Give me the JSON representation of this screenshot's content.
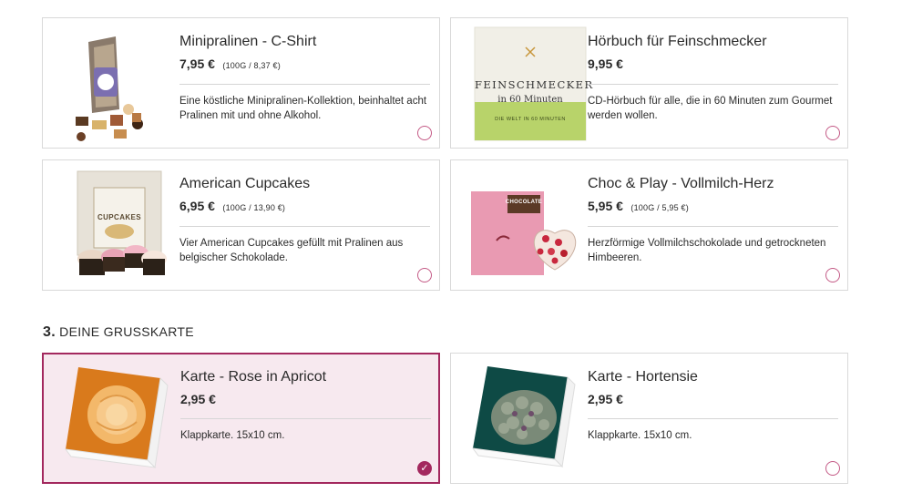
{
  "products": [
    {
      "title": "Minipralinen - C-Shirt",
      "price": "7,95 €",
      "unit": "(100G / 8,37 €)",
      "desc": "Eine köstliche Minipralinen-Kollektion, beinhaltet acht Pralinen mit und ohne Alkohol.",
      "icon": "pralines-image",
      "selected": false
    },
    {
      "title": "Hörbuch für Feinschmecker",
      "price": "9,95 €",
      "unit": "",
      "desc": "CD-Hörbuch für alle, die in 60 Minuten zum Gourmet werden wollen.",
      "icon": "audiobook-image",
      "selected": false,
      "cover": {
        "title": "FEINSCHMECKER",
        "subtitle": "in 60 Minuten",
        "band": "DIE WELT IN 60 MINUTEN"
      }
    },
    {
      "title": "American Cupcakes",
      "price": "6,95 €",
      "unit": "(100G / 13,90 €)",
      "desc": "Vier American Cupcakes gefüllt mit Pralinen aus belgischer Schokolade.",
      "icon": "cupcakes-image",
      "selected": false,
      "box_label": "CUPCAKES"
    },
    {
      "title": "Choc & Play - Vollmilch-Herz",
      "price": "5,95 €",
      "unit": "(100G / 5,95 €)",
      "desc": "Herzförmige Vollmilchschokolade und getrockneten Himbeeren.",
      "icon": "chocolate-heart-image",
      "selected": false,
      "box_label": "CHOCOLATE"
    }
  ],
  "section": {
    "number": "3.",
    "label": "DEINE GRUSSKARTE"
  },
  "cards": [
    {
      "title": "Karte - Rose in Apricot",
      "price": "2,95 €",
      "desc": "Klappkarte. 15x10 cm.",
      "icon": "rose-card-image",
      "selected": true
    },
    {
      "title": "Karte - Hortensie",
      "price": "2,95 €",
      "desc": "Klappkarte. 15x10 cm.",
      "icon": "hydrangea-card-image",
      "selected": false
    }
  ],
  "colors": {
    "accent": "#a3285e",
    "selected_bg": "#f7e9ef",
    "border": "#d9d9d9"
  }
}
